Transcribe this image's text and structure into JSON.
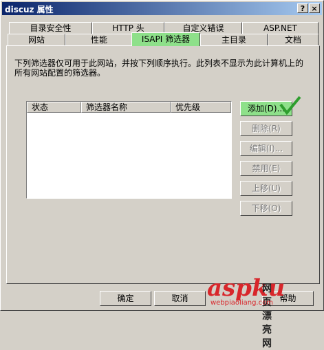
{
  "window": {
    "title": "discuz 属性",
    "help_glyph": "?",
    "close_glyph": "×"
  },
  "tabs_row1": [
    "目录安全性",
    "HTTP 头",
    "自定义错误",
    "ASP.NET"
  ],
  "tabs_row2": [
    "网站",
    "性能",
    "ISAPI 筛选器",
    "主目录",
    "文档"
  ],
  "active_tab": "ISAPI 筛选器",
  "description": "下列筛选器仅可用于此网站，并按下列顺序执行。此列表不显示为此计算机上的所有网站配置的筛选器。",
  "filters_table": {
    "columns": [
      "状态",
      "筛选器名称",
      "优先级"
    ],
    "rows": []
  },
  "side_buttons": {
    "add": "添加(D)...",
    "remove": "删除(R)",
    "edit": "编辑(I)...",
    "disable": "禁用(E)",
    "move_up": "上移(U)",
    "move_down": "下移(O)"
  },
  "footer_buttons": {
    "ok": "确定",
    "cancel": "取消",
    "help": "帮助"
  },
  "watermark": {
    "logo": "aspku",
    "cn": "网页漂亮网",
    "url": "webpiaoliang.com"
  },
  "colors": {
    "highlight_green": "#8ee08a",
    "check_green": "#2e9e2e",
    "title_blue": "#0a246a"
  }
}
